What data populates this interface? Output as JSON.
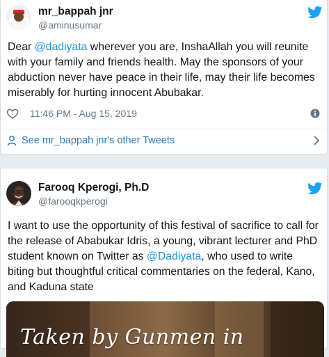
{
  "colors": {
    "twitter_blue": "#1da1f2",
    "link_blue": "#1b95e0",
    "secondary_text": "#657786"
  },
  "tweet1": {
    "display_name": "mr_bappah jnr",
    "handle": "@aminusumar",
    "text_before": "Dear ",
    "mention": "@dadiyata",
    "text_after": " wherever you are, InshaAllah you will reunite with your family and friends health. May the sponsors of your abduction never have peace in their life, may their life becomes miserably for hurting innocent Abubakar.",
    "timestamp": "11:46 PM - Aug 15, 2019",
    "see_more": "See mr_bappah jnr's other Tweets",
    "icons": [
      "twitter-bird-icon",
      "heart-icon",
      "info-icon",
      "person-icon",
      "chevron-right-icon"
    ]
  },
  "tweet2": {
    "display_name": "Farooq Kperogi, Ph.D",
    "handle": "@farooqkperogi",
    "text_before": "I want to use the opportunity of this festival of sacrifice to call for the release of Ababukar Idris, a young, vibrant lecturer and PhD student known on Twitter as ",
    "mention": "@Dadiyata",
    "text_after": ", who used to write biting but thoughtful critical commentaries on the federal, Kano, and Kaduna state",
    "photo_caption": "Taken by Gunmen in",
    "icons": [
      "twitter-bird-icon"
    ]
  }
}
